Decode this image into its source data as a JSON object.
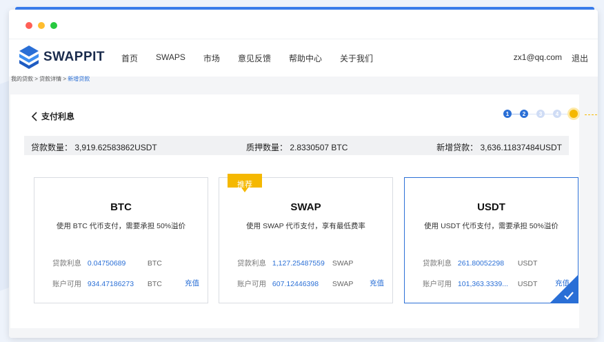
{
  "app": {
    "name": "SWAPPIT"
  },
  "nav": [
    "首页",
    "SWAPS",
    "市场",
    "意见反馈",
    "帮助中心",
    "关于我们"
  ],
  "user": {
    "email": "zx1@qq.com",
    "logout": "退出"
  },
  "breadcrumb": {
    "items": [
      "我的贷款",
      "贷款详情"
    ],
    "current": "新增贷款",
    "separator": ">"
  },
  "page": {
    "back_title": "支付利息"
  },
  "steps": {
    "labels": [
      "1",
      "2",
      "3",
      "4"
    ],
    "completed": 2,
    "total": 5
  },
  "summary": {
    "loan_amount": "贷款数量：  3,919.62583862USDT",
    "collateral": "质押数量：  2.8330507 BTC",
    "new_loan": "新增贷款：  3,636.11837484USDT"
  },
  "cards": [
    {
      "name": "BTC",
      "desc": "使用 BTC 代币支付，需要承担 50%溢价",
      "interest_label": "贷款利息",
      "interest_value": "0.04750689",
      "interest_unit": "BTC",
      "balance_label": "账户可用",
      "balance_value": "934.47186273",
      "balance_unit": "BTC",
      "recharge": "充值"
    },
    {
      "name": "SWAP",
      "badge": "推荐",
      "desc": "使用 SWAP 代币支付，享有最低费率",
      "interest_label": "贷款利息",
      "interest_value": "1,127.25487559",
      "interest_unit": "SWAP",
      "balance_label": "账户可用",
      "balance_value": "607.12446398",
      "balance_unit": "SWAP",
      "recharge": "充值"
    },
    {
      "name": "USDT",
      "desc": "使用 USDT 代币支付，需要承担 50%溢价",
      "interest_label": "贷款利息",
      "interest_value": "261.80052298",
      "interest_unit": "USDT",
      "balance_label": "账户可用",
      "balance_value": "101,363.3339...",
      "balance_unit": "USDT",
      "recharge": "充值",
      "selected": true
    }
  ],
  "colors": {
    "accent": "#2a6fd6",
    "badge": "#f5b800",
    "active_step": "#f5b800"
  }
}
